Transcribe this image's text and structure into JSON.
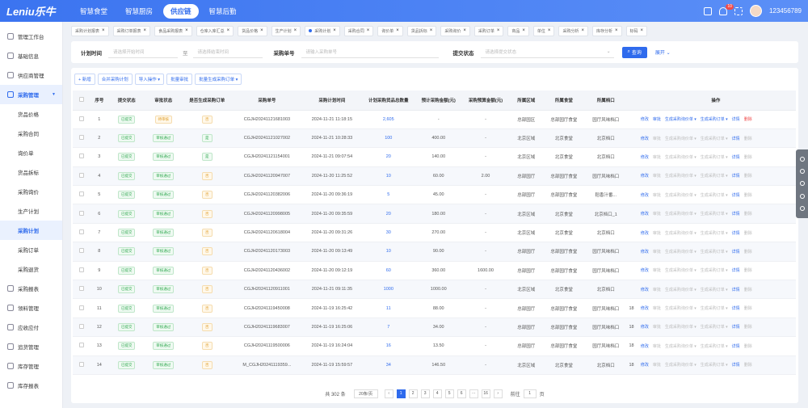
{
  "app": {
    "logo": "Leniu乐牛",
    "nav": [
      "智慧食堂",
      "智慧厨房",
      "供应链",
      "智慧后勤"
    ],
    "active_nav": 2,
    "notification_count": "10",
    "username": "123456789"
  },
  "sidebar": {
    "items": [
      {
        "label": "管理工作台",
        "type": "item"
      },
      {
        "label": "基础信息",
        "type": "item"
      },
      {
        "label": "供应商管理",
        "type": "item"
      },
      {
        "label": "采购管理",
        "type": "open"
      },
      {
        "label": "货品价格",
        "type": "sub"
      },
      {
        "label": "采购合同",
        "type": "sub"
      },
      {
        "label": "询价单",
        "type": "sub"
      },
      {
        "label": "货品拆标",
        "type": "sub"
      },
      {
        "label": "采购询价",
        "type": "sub"
      },
      {
        "label": "生产计划",
        "type": "sub"
      },
      {
        "label": "采购计划",
        "type": "subactive"
      },
      {
        "label": "采购订单",
        "type": "sub"
      },
      {
        "label": "采购退货",
        "type": "sub"
      },
      {
        "label": "采购报表",
        "type": "item"
      },
      {
        "label": "领料管理",
        "type": "item"
      },
      {
        "label": "应收应付",
        "type": "item"
      },
      {
        "label": "追货管理",
        "type": "item"
      },
      {
        "label": "库存管理",
        "type": "item"
      },
      {
        "label": "库存报表",
        "type": "item"
      }
    ]
  },
  "tabs": [
    {
      "label": "采购计划报表",
      "active": false
    },
    {
      "label": "采购订单报表",
      "active": false
    },
    {
      "label": "食品采购报表",
      "active": false
    },
    {
      "label": "仓库入库汇总",
      "active": false
    },
    {
      "label": "货品价格",
      "active": false
    },
    {
      "label": "生产计划",
      "active": false
    },
    {
      "label": "采购计划",
      "active": true
    },
    {
      "label": "采购合同",
      "active": false
    },
    {
      "label": "询价单",
      "active": false
    },
    {
      "label": "货品拆标",
      "active": false
    },
    {
      "label": "采购询价",
      "active": false
    },
    {
      "label": "采购订单",
      "active": false
    },
    {
      "label": "商品",
      "active": false
    },
    {
      "label": "单位",
      "active": false
    },
    {
      "label": "采购分析",
      "active": false
    },
    {
      "label": "库存分析",
      "active": false
    },
    {
      "label": "标码",
      "active": false
    }
  ],
  "filter": {
    "plan_time_label": "计划时间",
    "start_placeholder": "请选择开始时间",
    "to": "至",
    "end_placeholder": "请选择结束时间",
    "order_no_label": "采购单号",
    "order_no_placeholder": "请输入采购单号",
    "status_label": "提交状态",
    "status_placeholder": "请选择提交状态",
    "query": "查询",
    "expand": "展开"
  },
  "actions": [
    "+ 新增",
    "合并采购计划",
    "导入操作 ▾",
    "批量审批",
    "批量生成采购订单 ▾"
  ],
  "table": {
    "headers": [
      "",
      "序号",
      "提交状态",
      "审批状态",
      "是否生成采购订单",
      "采购单号",
      "采购计划时间",
      "计划采购货品总数量",
      "预计采购金额(元)",
      "采购预算金额(元)",
      "所属区域",
      "所属食堂",
      "所属档口",
      "",
      "操作"
    ],
    "rows": [
      [
        "1",
        "已提交",
        "待审核",
        "否",
        "CGJH20241121681003",
        "2024-11-21 11:18:15",
        "2,605",
        "-",
        "-",
        "总部园区",
        "总部园厅食堂",
        "园厅风味档口",
        "",
        true
      ],
      [
        "2",
        "已提交",
        "审核通过",
        "是",
        "CGJH20241121027002",
        "2024-11-21 10:28:33",
        "100",
        "400.00",
        "-",
        "北京区域",
        "北京食堂",
        "北京档口",
        "",
        false
      ],
      [
        "3",
        "已提交",
        "审核通过",
        "是",
        "CGJH20241121154001",
        "2024-11-21 09:07:54",
        "20",
        "140.00",
        "-",
        "北京区域",
        "北京食堂",
        "北京档口",
        "",
        false
      ],
      [
        "4",
        "已提交",
        "审核通过",
        "否",
        "CGJH20241120947007",
        "2024-11-20 11:25:52",
        "10",
        "60.00",
        "2.00",
        "总部园厅",
        "总部园厅食堂",
        "园厅风味档口",
        "",
        false
      ],
      [
        "5",
        "已提交",
        "审核通过",
        "否",
        "CGJH20241120382006",
        "2024-11-20 09:36:19",
        "5",
        "45.00",
        "-",
        "总部园厅",
        "总部园厅食堂",
        "稻香汁番...",
        "",
        false
      ],
      [
        "6",
        "已提交",
        "审核通过",
        "否",
        "CGJH20241120998005",
        "2024-11-20 09:35:59",
        "20",
        "180.00",
        "-",
        "北京区域",
        "北京食堂",
        "北京档口_1",
        "",
        false
      ],
      [
        "7",
        "已提交",
        "审核通过",
        "否",
        "CGJH20241120618004",
        "2024-11-20 09:31:26",
        "30",
        "270.00",
        "-",
        "北京区域",
        "北京食堂",
        "北京档口",
        "",
        false
      ],
      [
        "8",
        "已提交",
        "审核通过",
        "否",
        "CGJH20241120173003",
        "2024-11-20 09:13:49",
        "10",
        "90.00",
        "-",
        "总部园厅",
        "总部园厅食堂",
        "园厅风味档口",
        "",
        false
      ],
      [
        "9",
        "已提交",
        "审核通过",
        "否",
        "CGJH20241120436002",
        "2024-11-20 09:12:19",
        "60",
        "360.00",
        "1600.00",
        "总部园厅",
        "总部园厅食堂",
        "园厅风味档口",
        "",
        false
      ],
      [
        "10",
        "已提交",
        "审核通过",
        "否",
        "CGJH20241120911001",
        "2024-11-21 09:11:35",
        "1000",
        "1000.00",
        "-",
        "北京区域",
        "北京食堂",
        "北京档口",
        "",
        false
      ],
      [
        "11",
        "已提交",
        "审核通过",
        "否",
        "CGJH20241119450008",
        "2024-11-19 16:25:42",
        "11",
        "88.00",
        "-",
        "总部园厅",
        "总部园厅食堂",
        "园厅风味档口",
        "18",
        false
      ],
      [
        "12",
        "已提交",
        "审核通过",
        "否",
        "CGJH20241119683007",
        "2024-11-19 16:25:06",
        "7",
        "34.00",
        "-",
        "总部园厅",
        "总部园厅食堂",
        "园厅风味档口",
        "18",
        false
      ],
      [
        "13",
        "已提交",
        "审核通过",
        "否",
        "CGJH20241119500006",
        "2024-11-19 16:24:04",
        "16",
        "13.50",
        "-",
        "总部园厅",
        "总部园厅食堂",
        "园厅风味档口",
        "18",
        false
      ],
      [
        "14",
        "已提交",
        "审核通过",
        "否",
        "M_CGJH20241119359...",
        "2024-11-19 15:59:57",
        "34",
        "146.50",
        "-",
        "北京区域",
        "北京食堂",
        "北京档口",
        "18",
        false
      ]
    ],
    "ops": {
      "edit": "修改",
      "review": "审批",
      "gen_inquiry": "生成采购询价单 ▾",
      "gen_order": "生成采购订单 ▾",
      "detail": "详情",
      "delete": "删除"
    }
  },
  "pagination": {
    "total": "共 302 条",
    "page_size": "20条/页",
    "pages": [
      "‹",
      "1",
      "2",
      "3",
      "4",
      "5",
      "6",
      "···",
      "16",
      "›"
    ],
    "goto_label": "前往",
    "goto_value": "1",
    "page_unit": "页"
  }
}
